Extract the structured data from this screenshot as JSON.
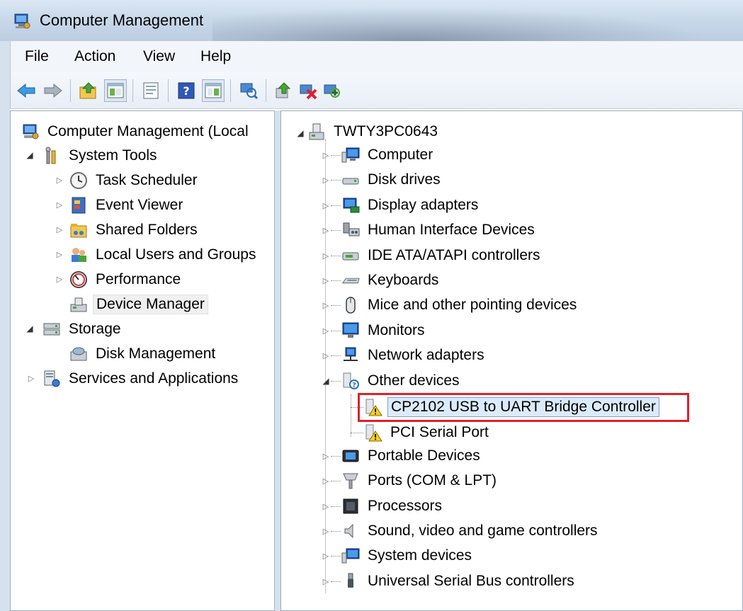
{
  "window": {
    "title": "Computer Management"
  },
  "menu": [
    "File",
    "Action",
    "View",
    "Help"
  ],
  "toolbar": {
    "icons": [
      "back-icon",
      "forward-icon",
      "up-folder-icon",
      "show-tree-icon",
      "properties-icon",
      "help-icon",
      "show-action-pane-icon",
      "scan-hardware-icon",
      "update-driver-icon",
      "uninstall-icon",
      "enable-device-icon"
    ]
  },
  "left_tree": {
    "root": "Computer Management (Local",
    "system_tools": "System Tools",
    "task_scheduler": "Task Scheduler",
    "event_viewer": "Event Viewer",
    "shared_folders": "Shared Folders",
    "local_users": "Local Users and Groups",
    "performance": "Performance",
    "device_manager": "Device Manager",
    "storage": "Storage",
    "disk_management": "Disk Management",
    "services": "Services and Applications"
  },
  "device_tree": {
    "root": "TWTY3PC0643",
    "categories": [
      "Computer",
      "Disk drives",
      "Display adapters",
      "Human Interface Devices",
      "IDE ATA/ATAPI controllers",
      "Keyboards",
      "Mice and other pointing devices",
      "Monitors",
      "Network adapters",
      "Other devices"
    ],
    "other_devices": [
      "CP2102 USB to UART Bridge Controller",
      "PCI Serial Port"
    ],
    "categories_after": [
      "Portable Devices",
      "Ports (COM & LPT)",
      "Processors",
      "Sound, video and game controllers",
      "System devices",
      "Universal Serial Bus controllers"
    ]
  },
  "colors": {
    "highlight": "#e0202a",
    "selection": "#dcebfc"
  }
}
